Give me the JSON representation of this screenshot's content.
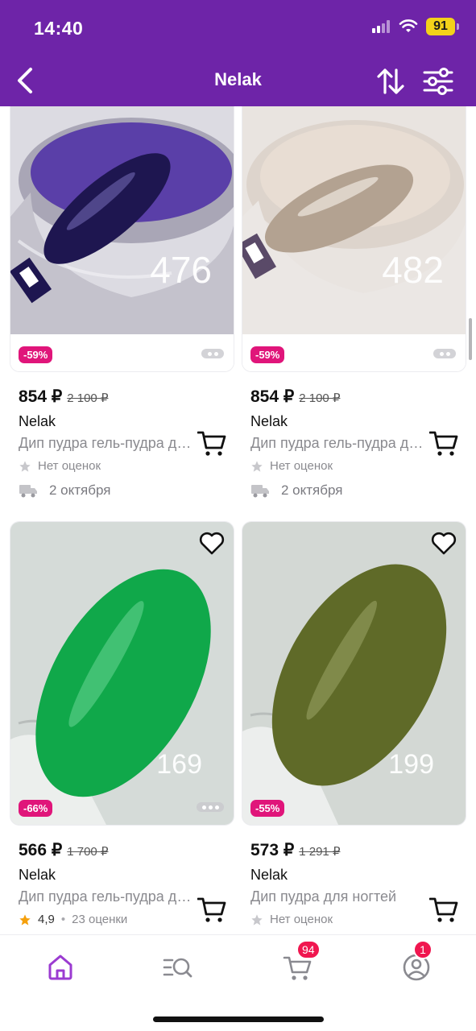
{
  "status_bar": {
    "time": "14:40",
    "battery": "91"
  },
  "header": {
    "title": "Nelak"
  },
  "products": [
    {
      "discount": "-59%",
      "price": "854 ₽",
      "old_price": "2 100 ₽",
      "brand": "Nelak",
      "title": "Дип пудра гель-пудра для ногтей",
      "rating_text": "Нет оценок",
      "delivery": "2 октября",
      "photo_number": "476",
      "nail_color": "#1e1650",
      "powder_color": "#5a3fa8"
    },
    {
      "discount": "-59%",
      "price": "854 ₽",
      "old_price": "2 100 ₽",
      "brand": "Nelak",
      "title": "Дип пудра гель-пудра для ногтей",
      "rating_text": "Нет оценок",
      "delivery": "2 октября",
      "photo_number": "482",
      "nail_color": "#b3a291",
      "powder_color": "#e8ddd3"
    },
    {
      "discount": "-66%",
      "price": "566 ₽",
      "old_price": "1 700 ₽",
      "brand": "Nelak",
      "title": "Дип пудра гель-пудра для ногтей",
      "rating_value": "4,9",
      "rating_count": "23 оценки",
      "photo_number": "169",
      "nail_color": "#10a84a"
    },
    {
      "discount": "-55%",
      "price": "573 ₽",
      "old_price": "1 291 ₽",
      "brand": "Nelak",
      "title": "Дип пудра для ногтей",
      "rating_text": "Нет оценок",
      "photo_number": "199",
      "nail_color": "#5f6a28"
    }
  ],
  "tabbar": {
    "items": [
      {
        "icon": "home-icon"
      },
      {
        "icon": "catalog-search-icon"
      },
      {
        "icon": "cart-icon",
        "badge": "94"
      },
      {
        "icon": "profile-icon",
        "badge": "1"
      }
    ]
  },
  "colors": {
    "brand_purple": "#6e24a8",
    "discount_pink": "#e0157a",
    "badge_red": "#f0164f",
    "active_tab": "#9b3bd1"
  }
}
